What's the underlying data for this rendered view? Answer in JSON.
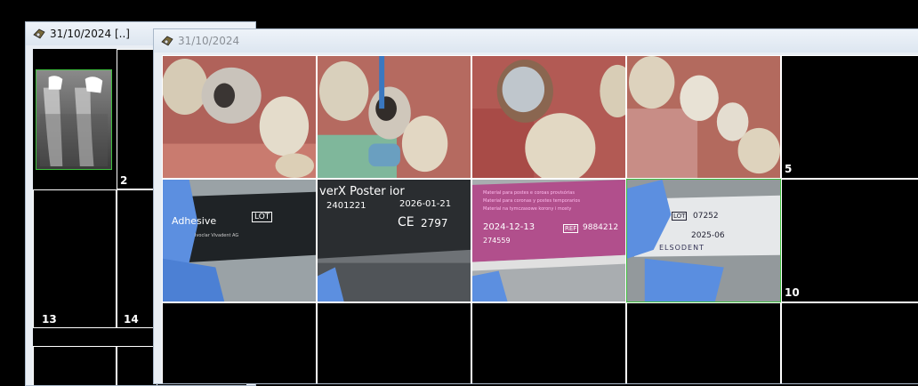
{
  "back_window": {
    "title": "31/10/2024 [..]",
    "cells": [
      {
        "number": "",
        "thumbnail": "xray",
        "selected": true
      },
      {
        "number": "2",
        "thumbnail": "empty",
        "selected": false
      },
      {
        "number": "13",
        "thumbnail": "empty",
        "selected": false
      },
      {
        "number": "14",
        "thumbnail": "empty",
        "selected": false
      }
    ]
  },
  "front_window": {
    "title": "31/10/2024",
    "cells": [
      {
        "number": "",
        "thumbnail": "intraoral-photo"
      },
      {
        "number": "",
        "thumbnail": "intraoral-photo"
      },
      {
        "number": "",
        "thumbnail": "intraoral-photo"
      },
      {
        "number": "",
        "thumbnail": "intraoral-photo"
      },
      {
        "number": "5",
        "thumbnail": "empty"
      },
      {
        "number": "",
        "thumbnail": "product-label"
      },
      {
        "number": "",
        "thumbnail": "product-label"
      },
      {
        "number": "",
        "thumbnail": "product-label"
      },
      {
        "number": "",
        "thumbnail": "product-label"
      },
      {
        "number": "10",
        "thumbnail": "empty"
      }
    ],
    "labels": {
      "adhesive": {
        "name": "Adhesive",
        "lot": "LOT",
        "maker": "Ivoclar Vivadent AG"
      },
      "everx": {
        "name": "verX Poster ior",
        "lot": "2401221",
        "exp": "2026-01-21",
        "ce": "CE",
        "code": "2797"
      },
      "pink": {
        "line1": "Material para postes e coroas provisórias",
        "line2": "Material para coronas y postes temporarios",
        "line3": "Material na tymczasowe korony i mosty",
        "date": "2024-12-13",
        "ref_label": "REF",
        "ref": "9884212",
        "lot": "274559"
      },
      "elsodent": {
        "lot_label": "LOT",
        "lot": "07252",
        "exp": "2025-06",
        "brand": "ELSODENT"
      }
    }
  },
  "colors": {
    "selection": "#3fbf3f",
    "cell_border": "#ffffff",
    "window_frame": "#e9eef4"
  }
}
